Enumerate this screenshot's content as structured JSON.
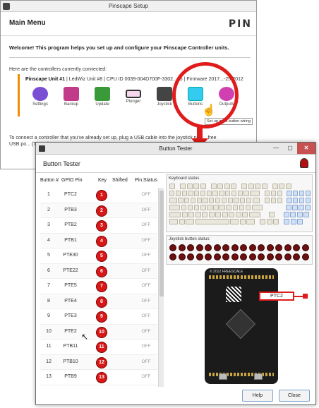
{
  "back_window": {
    "title": "Pinscape Setup",
    "header": "Main Menu",
    "logo": "PIN",
    "welcome": "Welcome! This program helps you set up and configure your Pinscape Controller units.",
    "connected": "Here are the controllers currently connected:",
    "unit_name": "Pinscape Unit #1",
    "unit_info": " | LedWiz Unit #8 | CPU ID 0039-004D700F-3302...45 | Firmware 2017...-25-2012",
    "icons": [
      "Settings",
      "Backup",
      "Update",
      "Plunger",
      "Joystick",
      "Buttons",
      "Outputs"
    ],
    "tooltip": "Set up input button wiring",
    "connect_text": "To connect a controller that you've already set up, plug a USB cable into the joystick port... free USB po... (The other..."
  },
  "window": {
    "title": "Button Tester",
    "header": "Button Tester",
    "help_label": "Help",
    "close_label": "Close"
  },
  "table": {
    "headers": [
      "Button #",
      "GPIO Pin",
      "Key",
      "Shifted",
      "Pin Status"
    ],
    "rows": [
      {
        "num": "1",
        "gpio": "PTC2",
        "key": "1",
        "status": "OFF"
      },
      {
        "num": "2",
        "gpio": "PTB3",
        "key": "2",
        "status": "OFF"
      },
      {
        "num": "3",
        "gpio": "PTB2",
        "key": "3",
        "status": "OFF"
      },
      {
        "num": "4",
        "gpio": "PTB1",
        "key": "4",
        "status": "OFF"
      },
      {
        "num": "5",
        "gpio": "PTE30",
        "key": "5",
        "status": "OFF"
      },
      {
        "num": "6",
        "gpio": "PTE22",
        "key": "6",
        "status": "OFF"
      },
      {
        "num": "7",
        "gpio": "PTE5",
        "key": "7",
        "status": "OFF"
      },
      {
        "num": "8",
        "gpio": "PTE4",
        "key": "8",
        "status": "OFF"
      },
      {
        "num": "9",
        "gpio": "PTE3",
        "key": "9",
        "status": "OFF"
      },
      {
        "num": "10",
        "gpio": "PTE2",
        "key": "10",
        "status": "OFF"
      },
      {
        "num": "11",
        "gpio": "PTB11",
        "key": "11",
        "status": "OFF"
      },
      {
        "num": "12",
        "gpio": "PTB10",
        "key": "12",
        "status": "OFF"
      },
      {
        "num": "13",
        "gpio": "PTB9",
        "key": "13",
        "status": "OFF"
      }
    ]
  },
  "panels": {
    "keyboard_label": "Keyboard status",
    "joystick_label": "Joystick button status:",
    "copyright": "© 2012 FREESCALE",
    "pin_callout": "PTC2"
  },
  "colors": {
    "accent_red": "#e01b1b",
    "key_red": "#d81818",
    "unit_bar": "#f08c00"
  }
}
